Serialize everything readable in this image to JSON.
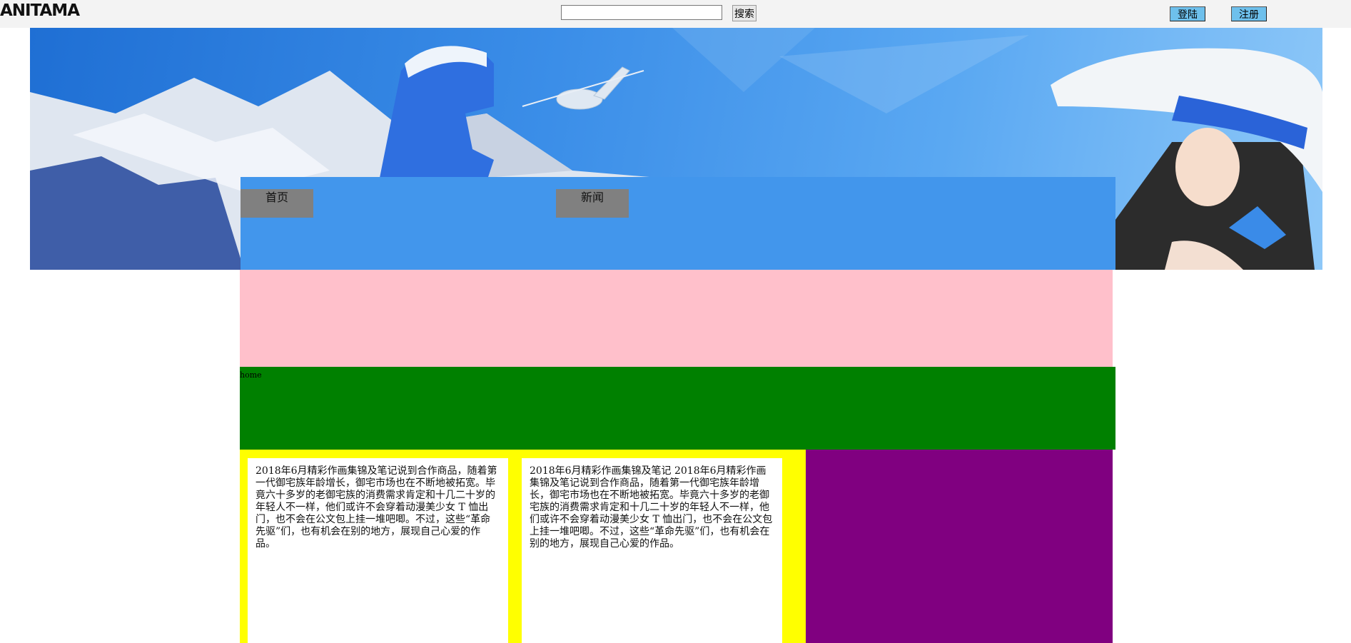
{
  "header": {
    "logo": "ANITAMA",
    "search": {
      "value": "",
      "placeholder": "",
      "button_label": "搜索"
    },
    "login_label": "登陆",
    "register_label": "注册"
  },
  "nav": {
    "items": [
      {
        "label": "首页"
      },
      {
        "label": "新闻"
      }
    ]
  },
  "content": {
    "green_label": "home",
    "cards": [
      {
        "text": "2018年6月精彩作画集锦及笔记说到合作商品，随着第一代御宅族年龄增长，御宅市场也在不断地被拓宽。毕竟六十多岁的老御宅族的消费需求肯定和十几二十岁的年轻人不一样，他们或许不会穿着动漫美少女 T 恤出门，也不会在公文包上挂一堆吧唧。不过，这些“革命先驱”们，也有机会在别的地方，展现自己心爱的作品。"
      },
      {
        "text": "2018年6月精彩作画集锦及笔记 2018年6月精彩作画集锦及笔记说到合作商品，随着第一代御宅族年龄增长，御宅市场也在不断地被拓宽。毕竟六十多岁的老御宅族的消费需求肯定和十几二十岁的年轻人不一样，他们或许不会穿着动漫美少女 T 恤出门，也不会在公文包上挂一堆吧唧。不过，这些“革命先驱”们，也有机会在别的地方，展现自己心爱的作品。"
      }
    ]
  },
  "colors": {
    "nav_bg": "#4296ec",
    "nav_item_bg": "#808080",
    "pink": "#ffc0cb",
    "green": "#008000",
    "yellow": "#ffff00",
    "purple": "#800080",
    "button_bg": "#6ec0ec"
  }
}
